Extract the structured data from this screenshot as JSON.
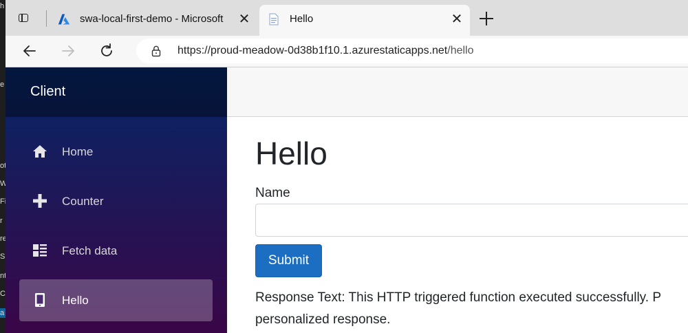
{
  "browser": {
    "tabs": [
      {
        "title": "swa-local-first-demo - Microsoft",
        "icon": "azure-logo-icon",
        "active": false
      },
      {
        "title": "Hello",
        "icon": "page-icon",
        "active": true
      }
    ],
    "address": {
      "url_base": "https://proud-meadow-0d38b1f10.1.azurestaticapps.net",
      "url_path": "/hello"
    }
  },
  "background_window_fragments": [
    "h",
    "e",
    "ot",
    "W",
    "Fi",
    "r",
    "re",
    "S",
    "nt",
    "C",
    "a"
  ],
  "sidebar": {
    "brand": "Client",
    "items": [
      {
        "label": "Home",
        "icon": "home-icon",
        "active": false
      },
      {
        "label": "Counter",
        "icon": "plus-icon",
        "active": false
      },
      {
        "label": "Fetch data",
        "icon": "list-rich-icon",
        "active": false
      },
      {
        "label": "Hello",
        "icon": "phone-icon",
        "active": true
      }
    ]
  },
  "main": {
    "heading": "Hello",
    "name_label": "Name",
    "name_value": "",
    "submit_label": "Submit",
    "response_line1": "Response Text: This HTTP triggered function executed successfully. P",
    "response_line2": "personalized response."
  },
  "colors": {
    "sidebar_top": "#052767",
    "sidebar_bottom": "#3a0647",
    "button": "#1b6ec2",
    "azure_blue": "#0078d4"
  }
}
